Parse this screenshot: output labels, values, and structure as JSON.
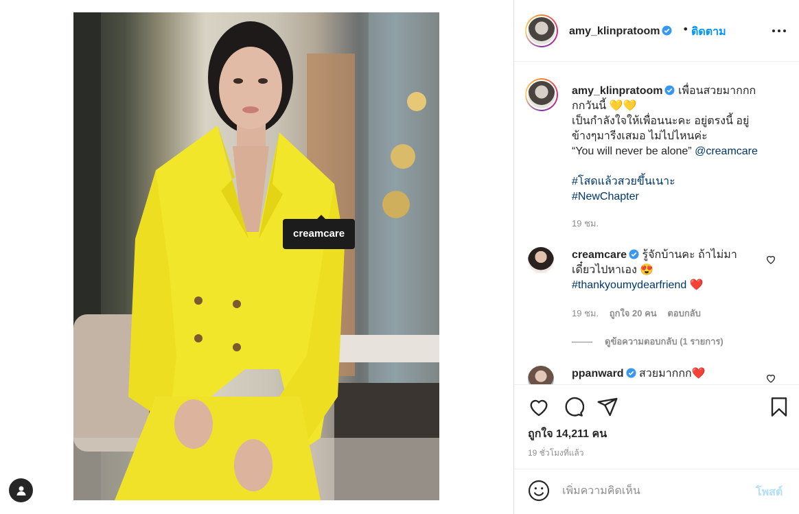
{
  "post": {
    "author": "amy_klinpratoom",
    "follow_label": "ติดตาม",
    "separator": "•",
    "photo_tag": "creamcare"
  },
  "caption": {
    "author": "amy_klinpratoom",
    "lines": [
      "เพื่อนสวยมากกก",
      "กกวันนี้ 💛💛",
      "เป็นกำลังใจให้เพื่อนนะคะ อยู่ตรงนี้ อยู่",
      "ข้างๆมารีงเสมอ ไม่ไปไหนค่ะ",
      "“You will never be alone”"
    ],
    "mention": "@creamcare",
    "hashtags": [
      "#โสดแล้วสวยขึ้นเนาะ",
      "#NewChapter"
    ],
    "time": "19 ชม."
  },
  "comments": [
    {
      "author": "creamcare",
      "text_line1": "รู้จักบ้านคะ ถ้าไม่มา",
      "text_line2": "เดี๋ยวไปหาเอง 😍",
      "hashtag": "#thankyoumydearfriend",
      "heart_emoji": "❤️",
      "time": "19 ชม.",
      "likes": "ถูกใจ 20 คน",
      "reply_label": "ตอบกลับ",
      "view_replies": "ดูข้อความตอบกลับ (1 รายการ)"
    },
    {
      "author": "ppanward",
      "text": "สวยมากกก❤️"
    }
  ],
  "likes_count": "ถูกใจ 14,211 คน",
  "post_time": "19 ชั่วโมงที่แล้ว",
  "add_comment": {
    "placeholder": "เพิ่มความคิดเห็น",
    "post_label": "โพสต์"
  },
  "colors": {
    "accent": "#0095f6",
    "link": "#00376b",
    "muted": "#8e8e8e",
    "heart_red": "#ed4956",
    "post_disabled": "#b2dffc",
    "suit_yellow": "#f2e62a"
  },
  "icons": [
    "verified-badge-icon",
    "more-options-icon",
    "heart-icon",
    "comment-icon",
    "share-icon",
    "bookmark-icon",
    "emoji-icon",
    "user-tag-icon"
  ]
}
